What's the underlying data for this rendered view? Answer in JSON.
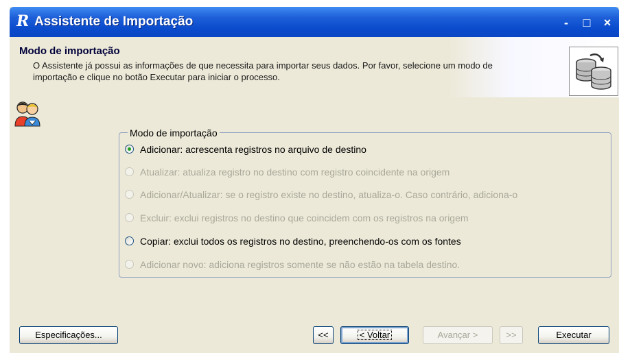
{
  "window": {
    "title": "Assistente de Importação",
    "app_icon": "R",
    "controls": {
      "minimize": "-",
      "maximize": "□",
      "close": "×"
    }
  },
  "header": {
    "title": "Modo de importação",
    "description": "O Assistente já possui as informações de que necessita para importar seus dados. Por favor, selecione um modo de importação e clique no botão Executar para iniciar o processo.",
    "icon": "database-import-icon"
  },
  "side_icon": "users-icon",
  "group": {
    "label": "Modo de importação",
    "options": [
      {
        "label": "Adicionar: acrescenta registros no arquivo de destino",
        "checked": true,
        "enabled": true
      },
      {
        "label": "Atualizar: atualiza registro no destino com registro coincidente na origem",
        "checked": false,
        "enabled": false
      },
      {
        "label": "Adicionar/Atualizar: se o registro existe no destino, atualiza-o. Caso contrário, adiciona-o",
        "checked": false,
        "enabled": false
      },
      {
        "label": "Excluir: exclui registros no destino que coincidem com os registros na origem",
        "checked": false,
        "enabled": false
      },
      {
        "label": "Copiar: exclui todos os registros no destino, preenchendo-os com os fontes",
        "checked": false,
        "enabled": true
      },
      {
        "label": "Adicionar novo: adiciona registros somente se não estão na tabela destino.",
        "checked": false,
        "enabled": false
      }
    ]
  },
  "buttons": {
    "specs": "Especificações...",
    "first": "<<",
    "back": "< Voltar",
    "next": "Avançar >",
    "last": ">>",
    "execute": "Executar"
  }
}
